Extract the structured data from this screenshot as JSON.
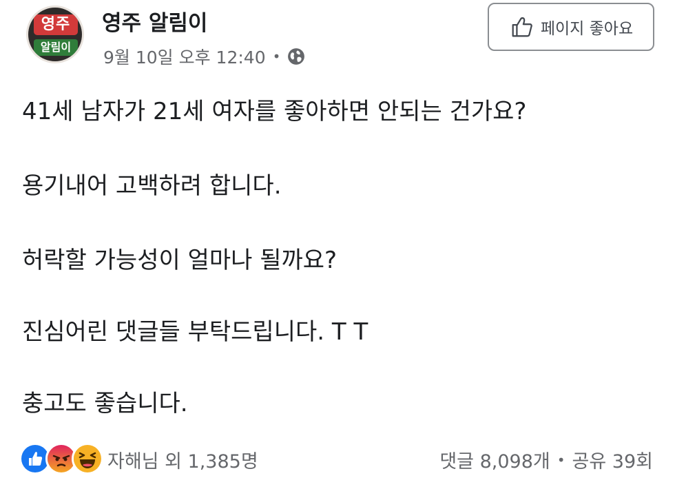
{
  "header": {
    "avatar": {
      "top_text": "영주",
      "bottom_text": "알림이",
      "top_color": "#d23a3a",
      "bottom_color": "#2f7d3a"
    },
    "page_name": "영주 알림이",
    "timestamp": "9월 10일 오후 12:40",
    "separator": "•",
    "privacy_icon": "globe-icon",
    "like_page_button": {
      "icon": "thumbs-up-icon",
      "label": "페이지 좋아요"
    }
  },
  "post": {
    "lines": [
      "41세 남자가 21세 여자를 좋아하면 안되는 건가요?",
      "용기내어 고백하려 합니다.",
      "허락할 가능성이 얼마나 될까요?",
      "진심어린 댓글들 부탁드립니다. T T",
      "충고도 좋습니다."
    ]
  },
  "footer": {
    "reactions": [
      {
        "name": "like",
        "icon": "like-reaction-icon",
        "color": "#1877f2"
      },
      {
        "name": "angry",
        "icon": "angry-reaction-icon",
        "color": "#e9710f"
      },
      {
        "name": "haha",
        "icon": "haha-reaction-icon",
        "color": "#f7b125"
      }
    ],
    "reactors_text": "자해님 외 1,385명",
    "comments_text": "댓글 8,098개",
    "separator": "•",
    "shares_text": "공유 39회"
  }
}
